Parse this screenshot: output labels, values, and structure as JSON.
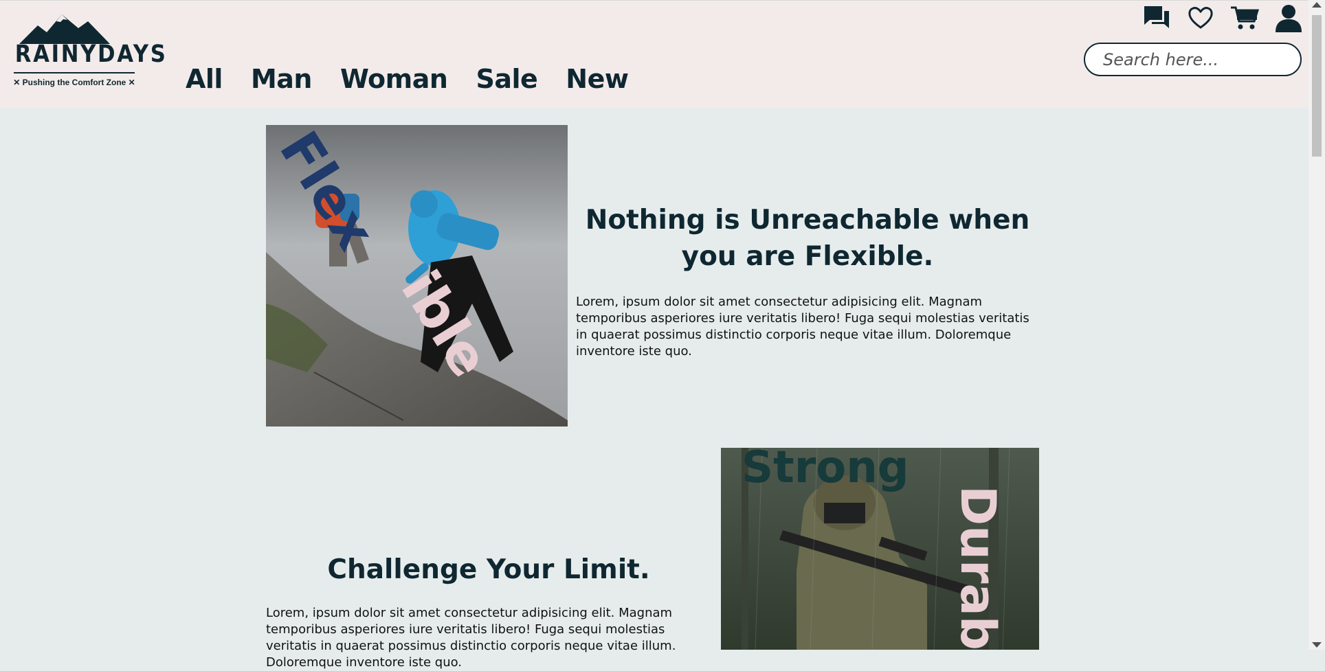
{
  "brand": {
    "name": "RAINYDAYS",
    "tagline": "✕ Pushing the Comfort Zone ✕"
  },
  "nav": {
    "items": [
      {
        "label": "All"
      },
      {
        "label": "Man"
      },
      {
        "label": "Woman"
      },
      {
        "label": "Sale"
      },
      {
        "label": "New"
      }
    ]
  },
  "header_icons": [
    "chat-icon",
    "heart-icon",
    "cart-icon",
    "user-icon"
  ],
  "search": {
    "placeholder": "Search here..."
  },
  "sections": [
    {
      "title": "Nothing is Unreachable when you are Flexible.",
      "body": "Lorem, ipsum dolor sit amet consectetur adipisicing elit. Magnam temporibus asperiores iure veritatis libero! Fuga sequi molestias veritatis in quaerat possimus distinctio corporis neque vitae illum. Doloremque inventore iste quo.",
      "image_words": [
        "Flex",
        "ible"
      ]
    },
    {
      "title": "Challenge Your Limit.",
      "body": "Lorem, ipsum dolor sit amet consectetur adipisicing elit. Magnam temporibus asperiores iure veritatis libero! Fuga sequi molestias veritatis in quaerat possimus distinctio corporis neque vitae illum. Doloremque inventore iste quo.",
      "image_words": [
        "Strong",
        "Durab"
      ]
    }
  ],
  "colors": {
    "header_bg": "#f3ebea",
    "page_bg": "#e6ecec",
    "primary_dark": "#0f2731",
    "accent_blue": "#1f3a6b",
    "accent_pink": "#e9cfd4"
  }
}
